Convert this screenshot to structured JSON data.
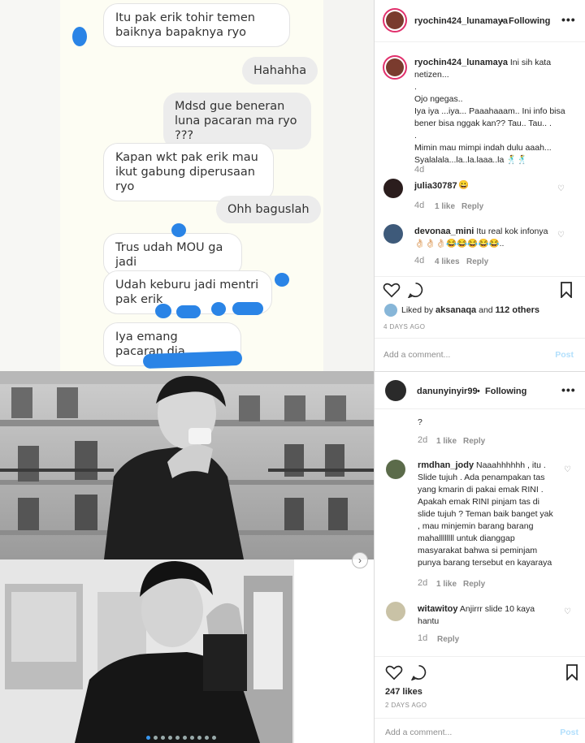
{
  "chat": {
    "messages": [
      {
        "side": "in",
        "text": "Itu pak erik tohir temen baiknya bapaknya ryo"
      },
      {
        "side": "out",
        "text": "Hahahha"
      },
      {
        "side": "out",
        "text": "Mdsd gue beneran luna pacaran ma ryo ???"
      },
      {
        "side": "in",
        "text": "Kapan wkt pak erik mau ikut gabung diperusaan ryo"
      },
      {
        "side": "out",
        "text": "Ohh baguslah"
      },
      {
        "side": "in",
        "text": "Trus udah MOU ga jadi"
      },
      {
        "side": "in",
        "text": "Udah keburu jadi mentri pak erik"
      },
      {
        "side": "in",
        "text": "Iya emang pacaran dia"
      }
    ]
  },
  "carousel": {
    "next_glyph": "›",
    "dot_count": 10,
    "active_dot": 0
  },
  "post1": {
    "header": {
      "username": "ryochin424_lunamaya",
      "separator": " • ",
      "follow": "Following",
      "more": "•••"
    },
    "caption": {
      "username": "ryochin424_lunamaya",
      "lines": [
        "Ini sih kata netizen...",
        ".",
        "Ojo ngegas..",
        "Iya iya ...iya... Paaahaaam.. Ini info bisa bener bisa nggak kan?? Tau.. Tau.. .",
        ".",
        "Mimin mau mimpi indah dulu aaah...",
        "Syalalala...la..la.laaa..la 🕺🕺"
      ],
      "time": "4d"
    },
    "comments": [
      {
        "username": "julia30787",
        "text": "😀",
        "time": "4d",
        "likes": "1 like",
        "reply": "Reply"
      },
      {
        "username": "devonaa_mini",
        "text": "Itu real kok infonya 👌🏻👌🏻👌🏻😂😂😂😂😂..",
        "time": "4d",
        "likes": "4 likes",
        "reply": "Reply"
      }
    ],
    "liked_by": {
      "prefix": "Liked by ",
      "user": "aksanaqa",
      "middle": " and ",
      "others": "112 others"
    },
    "date": "4 DAYS AGO",
    "add_comment": {
      "placeholder": "Add a comment...",
      "post": "Post"
    }
  },
  "post2": {
    "header": {
      "username": "danunyinyir99",
      "separator": " • ",
      "follow": "Following",
      "more": "•••"
    },
    "partial": {
      "text": "?",
      "time": "2d",
      "likes": "1 like",
      "reply": "Reply"
    },
    "comments": [
      {
        "username": "rmdhan_jody",
        "text": "Naaahhhhhh , itu . Slide tujuh . Ada penampakan tas yang kmarin di pakai emak RINI . Apakah emak RINI pinjam tas di slide tujuh ? Teman baik banget yak , mau minjemin barang barang mahallllllll untuk dianggap masyarakat bahwa si peminjam punya barang tersebut en kayaraya",
        "time": "2d",
        "likes": "1 like",
        "reply": "Reply"
      },
      {
        "username": "witawitoy",
        "text": "Anjirrr slide 10 kaya hantu",
        "time": "1d",
        "likes": "",
        "reply": "Reply"
      }
    ],
    "likes": "247 likes",
    "date": "2 DAYS AGO",
    "add_comment": {
      "placeholder": "Add a comment...",
      "post": "Post"
    }
  },
  "colors": {
    "accent": "#3897f0",
    "blob": "#2a84e6",
    "muted": "#8e8e8e",
    "post_disabled": "#b2dffc"
  }
}
